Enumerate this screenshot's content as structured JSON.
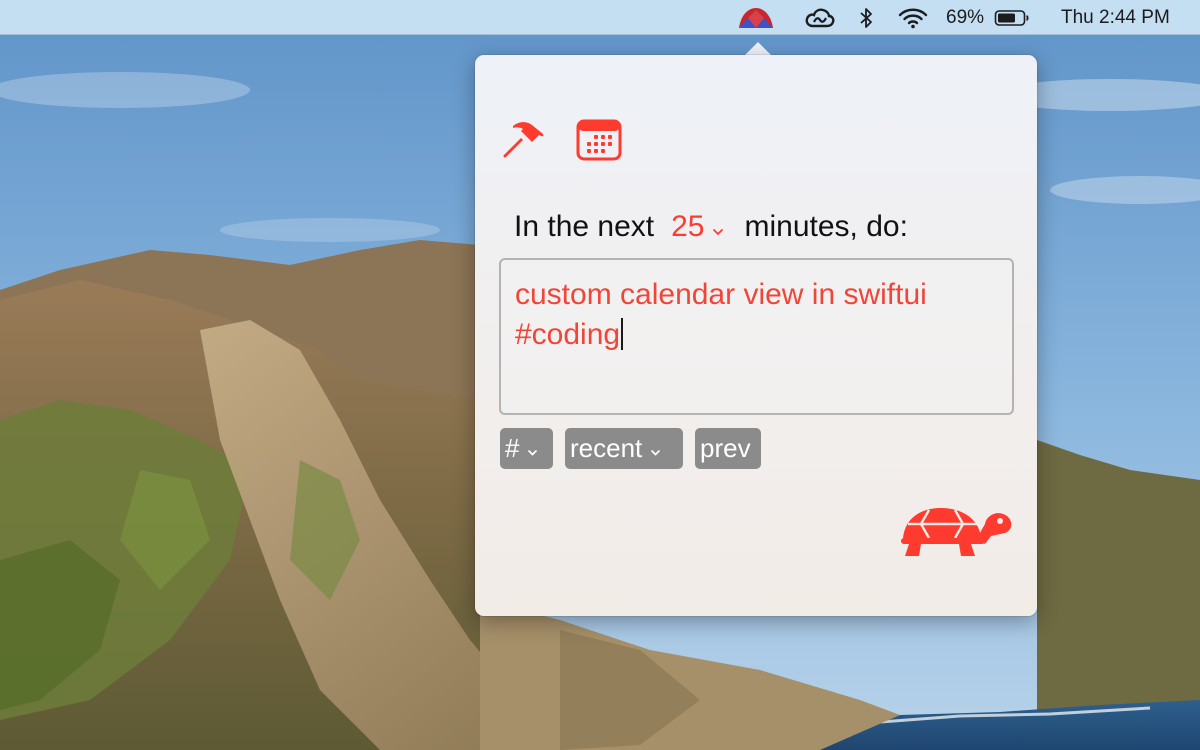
{
  "menubar": {
    "icons": [
      "turtle-app-icon",
      "creative-cloud-icon",
      "bluetooth-icon",
      "wifi-icon",
      "battery-icon"
    ],
    "battery_percent": "69%",
    "clock": "Thu 2:44 PM"
  },
  "popover": {
    "toolbar_icons": [
      "hammer-icon",
      "calendar-icon"
    ],
    "prompt": {
      "prefix": "In the next",
      "minutes_value": "25",
      "suffix": "minutes, do:"
    },
    "task_input": {
      "value": "custom calendar view in swiftui #coding"
    },
    "buttons": {
      "tag_label": "#",
      "recent_label": "recent",
      "prev_label": "prev"
    }
  },
  "colors": {
    "accent_red": "#ff3b30",
    "button_gray": "#8b8b8b"
  }
}
